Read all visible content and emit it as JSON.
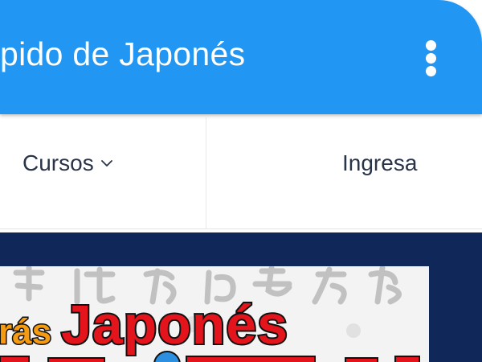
{
  "app_bar": {
    "title": "pido de Japonés",
    "menu_icon": "more-vert-icon",
    "background_color": "#2196f3"
  },
  "nav": {
    "cursos_label": "Cursos",
    "cursos_icon": "chevron-down-icon",
    "ingresa_label": "Ingresa"
  },
  "banner": {
    "text_small": "rás",
    "text_big": "Japonés",
    "background_color": "#10275a"
  }
}
